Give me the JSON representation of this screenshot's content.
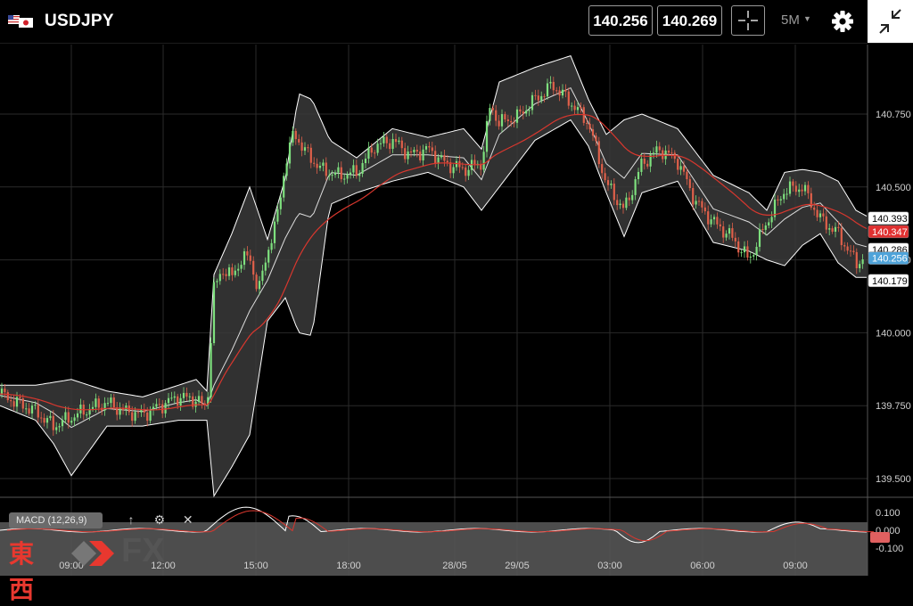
{
  "header": {
    "symbol": "USDJPY",
    "bid": "140.256",
    "ask": "140.269",
    "timeframe": "5M"
  },
  "colors": {
    "background": "#000000",
    "candle_up": "#7ee07e",
    "candle_down": "#e0604a",
    "bollinger": "#ffffff",
    "ma": "#d9372e",
    "price_tag_blue": "#4fa3d9",
    "price_tag_red": "#e03030"
  },
  "chart_data": {
    "type": "line",
    "symbol": "USDJPY",
    "timeframe": "5M",
    "y_ticks": [
      "140.750",
      "140.500",
      "140.250",
      "140.000",
      "139.750",
      "139.500"
    ],
    "y_range": [
      139.47,
      140.98
    ],
    "x_ticks": [
      "09:00",
      "12:00",
      "15:00",
      "18:00",
      "28/05",
      "29/05",
      "03:00",
      "06:00",
      "09:00"
    ],
    "price_tags": [
      {
        "value": "140.393",
        "style": "white"
      },
      {
        "value": "140.347",
        "style": "red"
      },
      {
        "value": "140.286",
        "style": "white"
      },
      {
        "value": "140.256",
        "style": "blue"
      },
      {
        "value": "140.179",
        "style": "white"
      }
    ],
    "series": [
      {
        "name": "price",
        "style": "candles",
        "x": [
          0,
          20,
          40,
          60,
          80,
          100,
          120,
          140,
          160,
          180,
          200,
          220,
          232,
          240,
          250,
          260,
          270,
          280,
          290,
          300,
          310,
          320,
          330,
          340,
          360,
          380,
          400,
          420,
          440,
          460,
          480,
          500,
          520,
          540,
          550,
          560,
          580,
          600,
          620,
          640,
          660,
          680,
          700,
          720,
          740,
          760,
          780,
          800,
          820,
          840,
          860,
          880,
          900,
          920,
          940,
          960,
          972
        ],
        "values": [
          139.79,
          139.76,
          139.73,
          139.68,
          139.71,
          139.74,
          139.76,
          139.73,
          139.72,
          139.75,
          139.78,
          139.77,
          139.74,
          140.15,
          140.22,
          140.19,
          140.25,
          140.26,
          140.14,
          140.28,
          140.38,
          140.58,
          140.69,
          140.63,
          140.56,
          140.54,
          140.55,
          140.64,
          140.66,
          140.61,
          140.63,
          140.58,
          140.56,
          140.58,
          140.78,
          140.72,
          140.74,
          140.8,
          140.85,
          140.79,
          140.72,
          140.51,
          140.42,
          140.58,
          140.63,
          140.59,
          140.45,
          140.38,
          140.33,
          140.25,
          140.38,
          140.49,
          140.5,
          140.39,
          140.34,
          140.24,
          140.26
        ]
      },
      {
        "name": "bollinger_upper",
        "style": "line",
        "x": [
          0,
          40,
          80,
          120,
          160,
          200,
          220,
          232,
          240,
          260,
          280,
          300,
          320,
          335,
          350,
          370,
          400,
          440,
          480,
          520,
          540,
          560,
          600,
          640,
          660,
          680,
          700,
          720,
          760,
          800,
          840,
          860,
          880,
          900,
          920,
          940,
          960,
          972
        ],
        "values": [
          139.82,
          139.82,
          139.84,
          139.8,
          139.78,
          139.82,
          139.84,
          139.8,
          140.2,
          140.34,
          140.5,
          140.32,
          140.53,
          140.82,
          140.8,
          140.66,
          140.6,
          140.7,
          140.67,
          140.7,
          140.63,
          140.86,
          140.91,
          140.95,
          140.8,
          140.68,
          140.73,
          140.75,
          140.7,
          140.54,
          140.48,
          140.42,
          140.55,
          140.56,
          140.55,
          140.52,
          140.42,
          140.4
        ]
      },
      {
        "name": "bollinger_lower",
        "style": "line",
        "x": [
          0,
          40,
          60,
          80,
          120,
          160,
          200,
          220,
          232,
          240,
          260,
          280,
          300,
          320,
          335,
          350,
          370,
          400,
          440,
          480,
          520,
          540,
          560,
          600,
          640,
          660,
          680,
          700,
          720,
          760,
          800,
          840,
          860,
          880,
          900,
          920,
          940,
          960,
          972
        ],
        "values": [
          139.75,
          139.7,
          139.62,
          139.51,
          139.68,
          139.68,
          139.7,
          139.7,
          139.7,
          139.44,
          139.54,
          139.65,
          140.04,
          140.12,
          140.0,
          139.99,
          140.44,
          140.48,
          140.52,
          140.55,
          140.5,
          140.42,
          140.5,
          140.66,
          140.73,
          140.64,
          140.48,
          140.33,
          140.48,
          140.52,
          140.31,
          140.28,
          140.25,
          140.23,
          140.3,
          140.34,
          140.24,
          140.19,
          140.19
        ]
      }
    ],
    "macd": {
      "label": "MACD (12,26,9)",
      "y_ticks": [
        "0.100",
        "0.000",
        "-0.100"
      ]
    }
  },
  "macd_tools": {
    "up": "↑",
    "settings": "⚙",
    "close": "✕"
  },
  "watermark": {
    "kanji": "東西",
    "fx": "FX"
  }
}
